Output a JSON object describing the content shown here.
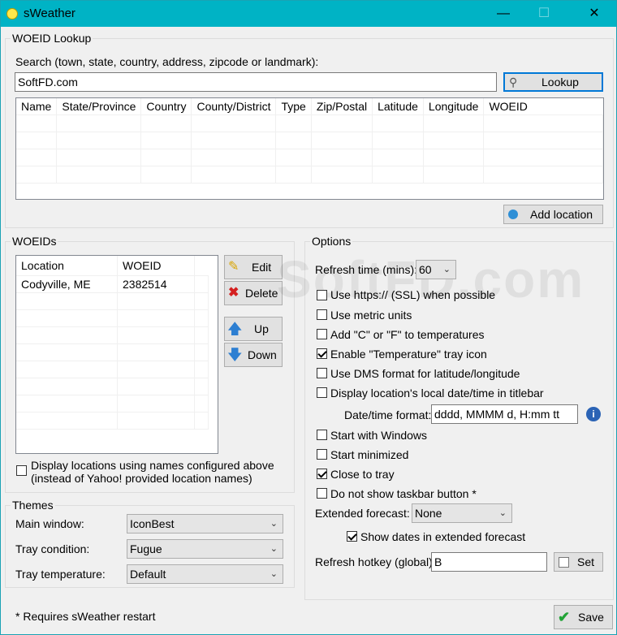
{
  "window": {
    "title": "sWeather"
  },
  "lookup": {
    "group_title": "WOEID Lookup",
    "search_label": "Search (town, state, country, address, zipcode or landmark):",
    "search_value": "SoftFD.com",
    "lookup_button": "Lookup",
    "columns": [
      "Name",
      "State/Province",
      "Country",
      "County/District",
      "Type",
      "Zip/Postal",
      "Latitude",
      "Longitude",
      "WOEID"
    ],
    "add_location_button": "Add location"
  },
  "woeids": {
    "group_title": "WOEIDs",
    "columns": [
      "Location",
      "WOEID"
    ],
    "rows": [
      {
        "location": "Codyville, ME",
        "woeid": "2382514"
      }
    ],
    "edit_button": "Edit",
    "delete_button": "Delete",
    "up_button": "Up",
    "down_button": "Down",
    "display_names_label_1": "Display locations using names configured above",
    "display_names_label_2": "(instead of Yahoo! provided location names)"
  },
  "themes": {
    "group_title": "Themes",
    "main_window_label": "Main window:",
    "main_window_value": "IconBest",
    "tray_condition_label": "Tray condition:",
    "tray_condition_value": "Fugue",
    "tray_temperature_label": "Tray temperature:",
    "tray_temperature_value": "Default"
  },
  "options": {
    "group_title": "Options",
    "refresh_time_label": "Refresh time (mins):",
    "refresh_time_value": "60",
    "use_https": "Use https:// (SSL) when possible",
    "metric": "Use metric units",
    "add_cf": "Add \"C\" or \"F\" to temperatures",
    "enable_tray": "Enable \"Temperature\" tray icon",
    "dms": "Use DMS format for latitude/longitude",
    "local_date": "Display location's local date/time in titlebar",
    "datetime_format_label": "Date/time format:",
    "datetime_format_value": "dddd, MMMM d, H:mm tt",
    "start_windows": "Start with Windows",
    "start_min": "Start minimized",
    "close_tray": "Close to tray",
    "no_taskbar": "Do not show taskbar button *",
    "extended_label": "Extended forecast:",
    "extended_value": "None",
    "show_dates": "Show dates in extended forecast",
    "hotkey_label": "Refresh hotkey (global):",
    "hotkey_value": "B",
    "set_button": "Set"
  },
  "footer": {
    "note": "* Requires sWeather restart",
    "save_button": "Save"
  },
  "watermark": "SoftFD.com"
}
